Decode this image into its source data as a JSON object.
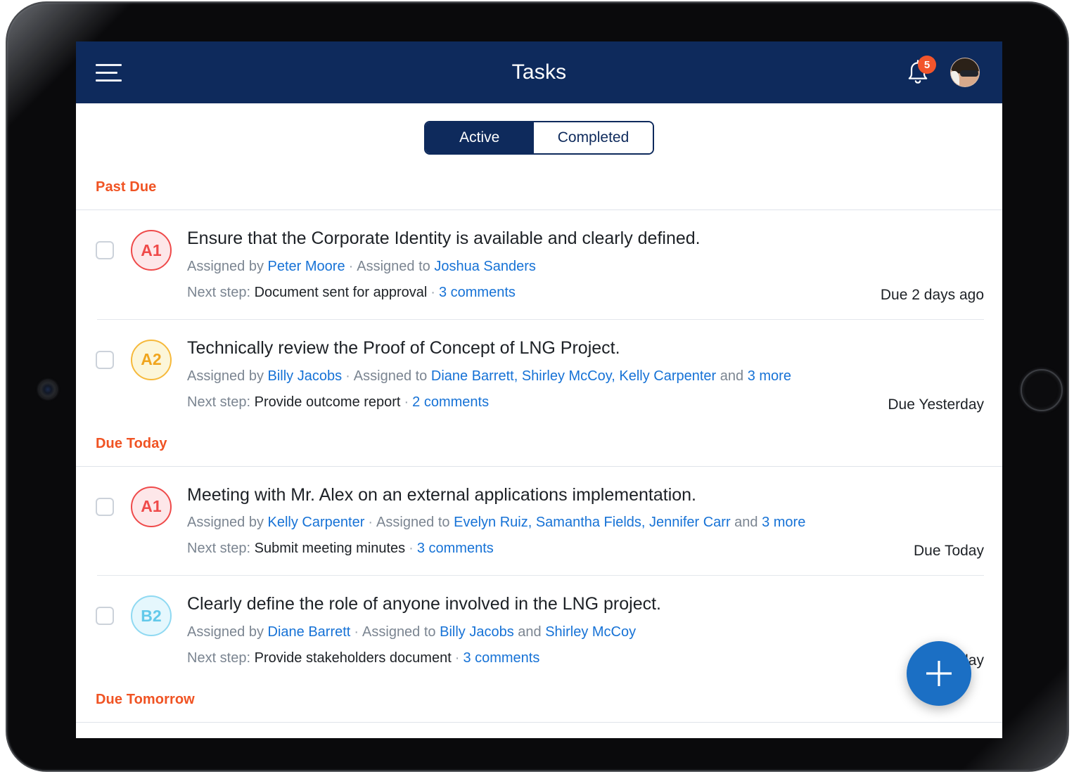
{
  "app": {
    "title": "Tasks",
    "menu_icon": "hamburger-menu-icon",
    "notification_icon": "bell-icon",
    "notification_count": "5",
    "avatar_alt": "user-avatar",
    "header_color": "#0e2a5c",
    "accent_orange": "#f05323",
    "link_blue": "#1672d6",
    "fab_blue": "#1b6fc4"
  },
  "tabs": [
    {
      "label": "Active",
      "active": true
    },
    {
      "label": "Completed",
      "active": false
    }
  ],
  "groups": [
    {
      "header": "Past Due",
      "tasks": [
        {
          "priority": "A1",
          "priority_color": "red",
          "title": "Ensure that the Corporate Identity is available and clearly defined.",
          "assigned_by_label": "Assigned by ",
          "assigned_by": "Peter Moore",
          "assigned_to_label": "Assigned to ",
          "assignees": "Joshua Sanders",
          "assignees_more": "",
          "next_step_label": "Next step: ",
          "next_step": "Document sent for approval",
          "comments": "3 comments",
          "due": "Due 2 days ago"
        },
        {
          "priority": "A2",
          "priority_color": "amber",
          "title": "Technically review the Proof of Concept of LNG Project.",
          "assigned_by_label": "Assigned by ",
          "assigned_by": "Billy Jacobs",
          "assigned_to_label": "Assigned to ",
          "assignees": "Diane Barrett, Shirley McCoy, Kelly Carpenter",
          "assignees_more": "3 more",
          "next_step_label": "Next step: ",
          "next_step": "Provide outcome report",
          "comments": "2 comments",
          "due": "Due Yesterday"
        }
      ]
    },
    {
      "header": "Due Today",
      "tasks": [
        {
          "priority": "A1",
          "priority_color": "red",
          "title": "Meeting with Mr. Alex on an external applications implementation.",
          "assigned_by_label": "Assigned by ",
          "assigned_by": "Kelly Carpenter",
          "assigned_to_label": "Assigned to ",
          "assignees": "Evelyn Ruiz, Samantha Fields, Jennifer Carr",
          "assignees_more": "3 more",
          "next_step_label": "Next step: ",
          "next_step": "Submit meeting minutes",
          "comments": "3 comments",
          "due": "Due Today"
        },
        {
          "priority": "B2",
          "priority_color": "cyan",
          "title": "Clearly define the role of anyone involved in the LNG project.",
          "assigned_by_label": "Assigned by ",
          "assigned_by": "Diane Barrett",
          "assigned_to_label": "Assigned to ",
          "assignees": "Billy Jacobs",
          "assignees_and": "Shirley McCoy",
          "assignees_more": "",
          "next_step_label": "Next step: ",
          "next_step": "Provide stakeholders document",
          "comments": "3 comments",
          "due": "Due Today"
        }
      ]
    },
    {
      "header": "Due Tomorrow",
      "tasks": []
    }
  ],
  "fab": {
    "label": "add-task",
    "icon": "plus-icon"
  },
  "connectors": {
    "and": " and ",
    "comma": ", "
  }
}
